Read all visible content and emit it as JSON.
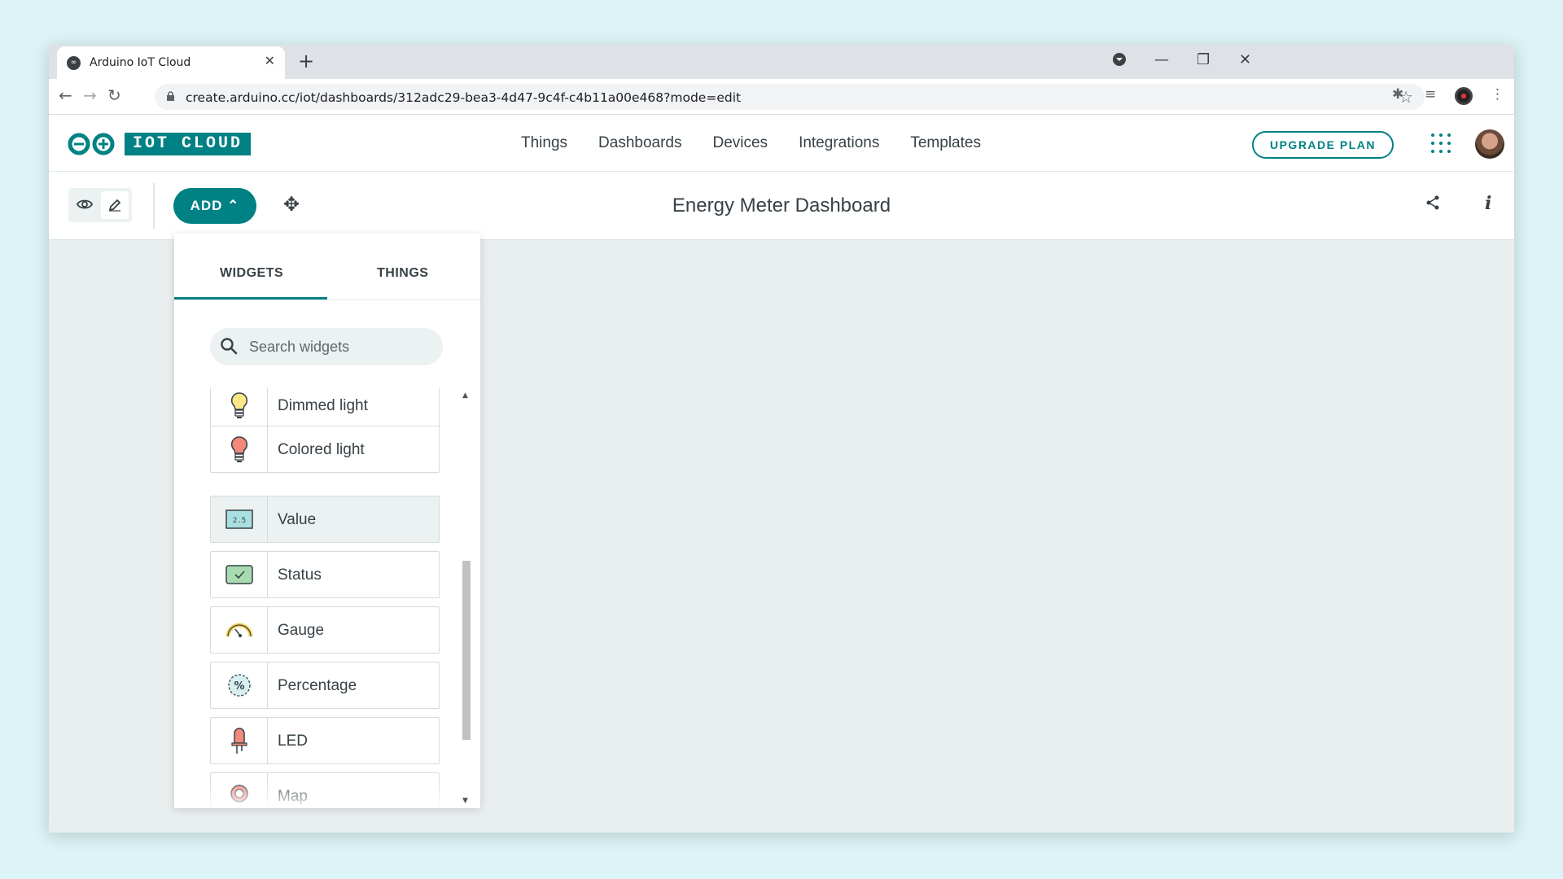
{
  "browser": {
    "tab_title": "Arduino IoT Cloud",
    "tab_close": "✕",
    "new_tab": "+",
    "url": "create.arduino.cc/iot/dashboards/312adc29-bea3-4d47-9c4f-c4b11a00e468?mode=edit",
    "window_controls": {
      "minimize": "—",
      "maximize": "❐",
      "close": "✕"
    }
  },
  "header": {
    "logo_text": "IOT CLOUD",
    "nav": [
      "Things",
      "Dashboards",
      "Devices",
      "Integrations",
      "Templates"
    ],
    "upgrade_label": "UPGRADE PLAN"
  },
  "dashboard": {
    "add_label": "ADD ⌃",
    "title": "Energy Meter Dashboard"
  },
  "panel": {
    "tabs": [
      "WIDGETS",
      "THINGS"
    ],
    "active_tab": "WIDGETS",
    "search_placeholder": "Search widgets",
    "widgets": [
      {
        "label": "Dimmed light",
        "icon": "dimmed-light-icon"
      },
      {
        "label": "Colored light",
        "icon": "colored-light-icon"
      },
      {
        "label": "Value",
        "icon": "value-icon",
        "selected": true
      },
      {
        "label": "Status",
        "icon": "status-icon"
      },
      {
        "label": "Gauge",
        "icon": "gauge-icon"
      },
      {
        "label": "Percentage",
        "icon": "percentage-icon"
      },
      {
        "label": "LED",
        "icon": "led-icon"
      },
      {
        "label": "Map",
        "icon": "map-icon"
      }
    ]
  },
  "colors": {
    "accent": "#008184",
    "page_bg": "#dcf4f6",
    "canvas_bg": "#e9eeee"
  }
}
